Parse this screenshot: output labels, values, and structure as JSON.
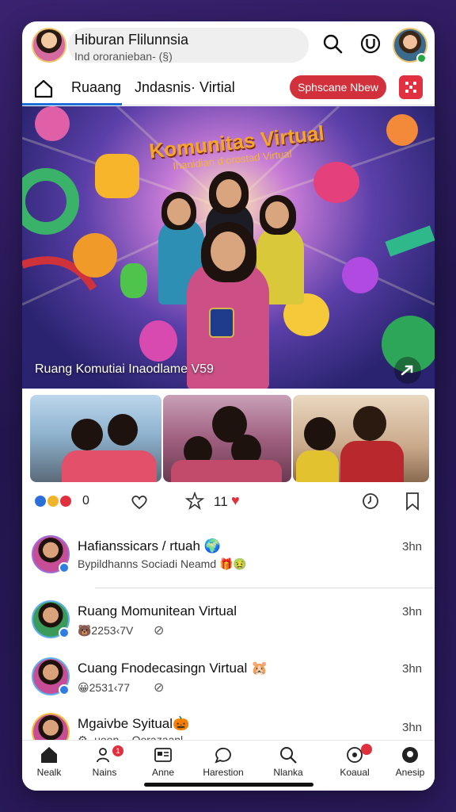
{
  "header": {
    "title": "Hiburan Flilunnsia",
    "subtitle": "Ind ororanieban- (§)",
    "icons": [
      "search-icon",
      "u-circle-icon"
    ]
  },
  "tabs": {
    "home_icon": "home-icon",
    "active": "Ruaang",
    "other": "Jndasnis· Virtial",
    "cta": "Sphscane Nbew",
    "menu_icon": "grid-menu-icon"
  },
  "hero": {
    "title": "Komunitas Virtual",
    "subtitle": "Ihanidian d orostad Virtual",
    "caption": "Ruang Komutiai Inaodlame V59",
    "share_icon": "share-arrow-icon"
  },
  "actions": {
    "reaction_count": "0",
    "likes_count": "11",
    "icons": [
      "heart-icon",
      "star-icon",
      "clock-icon",
      "bookmark-icon"
    ]
  },
  "feed": [
    {
      "title": "Hafianssicars / rtuah 🌍",
      "sub": "Bypildhanns Sociadi Neamd 🎁🤢",
      "time": "3hn"
    },
    {
      "title": "Ruang Momunitean Virtual",
      "sub": "🐻2253‹7V",
      "time": "3hn"
    },
    {
      "title": "Cuang Fnodecasingn Virtual 🐹",
      "sub": "😀2531‹77",
      "time": "3hn"
    },
    {
      "title": "Mgaivbe Syitual🎃",
      "sub": "⚙ ·uoon .· Oorazaanl",
      "time": "3hn"
    }
  ],
  "bottom_nav": [
    {
      "label": "Nealk",
      "icon": "home-icon"
    },
    {
      "label": "Nains",
      "icon": "people-icon",
      "badge": "1"
    },
    {
      "label": "Anne",
      "icon": "id-card-icon"
    },
    {
      "label": "Harestion",
      "icon": "chat-icon"
    },
    {
      "label": "Nlanka",
      "icon": "search-icon"
    },
    {
      "label": "Koaual",
      "icon": "notification-icon",
      "badge": ""
    },
    {
      "label": "Anesip",
      "icon": "account-icon"
    }
  ],
  "colors": {
    "accent": "#1e6fd9",
    "cta_red": "#d2303a",
    "background": "#2b1a5c"
  }
}
